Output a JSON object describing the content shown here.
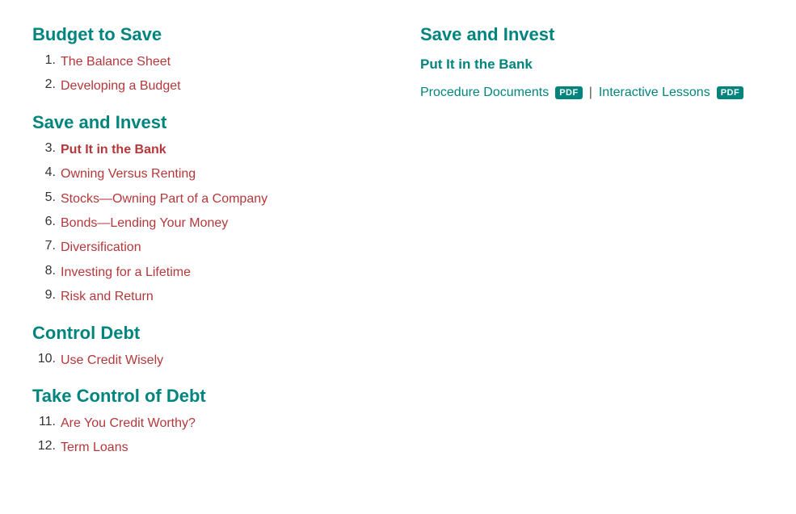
{
  "left": {
    "sections": [
      {
        "id": "budget-to-save",
        "heading": "Budget to Save",
        "items": [
          {
            "number": "1.",
            "label": "The Balance Sheet",
            "active": false
          },
          {
            "number": "2.",
            "label": "Developing a Budget",
            "active": false
          }
        ]
      },
      {
        "id": "save-and-invest",
        "heading": "Save and Invest",
        "items": [
          {
            "number": "3.",
            "label": "Put It in the Bank",
            "active": true
          },
          {
            "number": "4.",
            "label": "Owning Versus Renting",
            "active": false
          },
          {
            "number": "5.",
            "label": "Stocks—Owning Part of a Company",
            "active": false
          },
          {
            "number": "6.",
            "label": "Bonds—Lending Your Money",
            "active": false
          },
          {
            "number": "7.",
            "label": "Diversification",
            "active": false
          },
          {
            "number": "8.",
            "label": "Investing for a Lifetime",
            "active": false
          },
          {
            "number": "9.",
            "label": "Risk and Return",
            "active": false
          }
        ]
      },
      {
        "id": "control-debt",
        "heading": "Control Debt",
        "items": [
          {
            "number": "10.",
            "label": "Use Credit Wisely",
            "active": false
          }
        ]
      },
      {
        "id": "take-control-of-debt",
        "heading": "Take Control of Debt",
        "items": [
          {
            "number": "11.",
            "label": "Are You Credit Worthy?",
            "active": false
          },
          {
            "number": "12.",
            "label": "Term Loans",
            "active": false
          }
        ]
      }
    ]
  },
  "right": {
    "heading": "Save and Invest",
    "sub_heading": "Put It in the Bank",
    "procedure_label": "Procedure Documents",
    "pdf_badge1": "PDF",
    "separator": "|",
    "interactive_label": "Interactive Lessons",
    "pdf_badge2": "PDF"
  }
}
